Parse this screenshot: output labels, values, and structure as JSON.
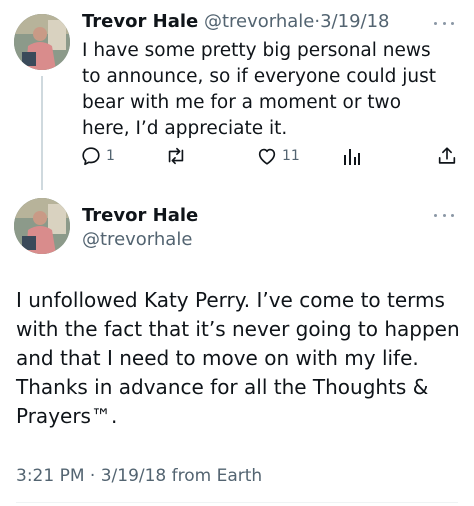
{
  "tweet1": {
    "author_name": "Trevor Hale",
    "author_handle": "@trevorhale",
    "separator": "·",
    "date": "3/19/18",
    "text": "I have some pretty big personal news to announce, so if everyone could just bear with me for a moment or two here, I’d appreciate it.",
    "more_icon": "ellipsis-icon",
    "actions": {
      "reply_count": "1",
      "retweet_count": "",
      "like_count": "11",
      "views_icon": "bar-chart-icon",
      "share_icon": "share-icon"
    }
  },
  "tweet2": {
    "author_name": "Trevor Hale",
    "author_handle": "@trevorhale",
    "text": "I unfollowed Katy Perry. I’ve come to terms with the fact that it’s never going to happen and that I need to move on with my life. Thanks in advance for all the Thoughts & Prayers™.",
    "meta": "3:21 PM · 3/19/18 from Earth",
    "more_icon": "ellipsis-icon"
  },
  "colors": {
    "text_primary": "#0f1419",
    "text_secondary": "#536471",
    "thread_line": "#cfd9de"
  }
}
